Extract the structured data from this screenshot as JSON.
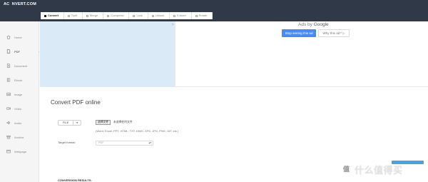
{
  "app": {
    "logo": "AC  NVERT.COM"
  },
  "tabs": [
    {
      "label": "Convert",
      "active": true
    },
    {
      "label": "Split",
      "active": false
    },
    {
      "label": "Merge",
      "active": false
    },
    {
      "label": "Compress",
      "active": false
    },
    {
      "label": "Lock",
      "active": false
    },
    {
      "label": "Unlock",
      "active": false
    },
    {
      "label": "Extract",
      "active": false
    },
    {
      "label": "Rotate",
      "active": false
    }
  ],
  "sidebar": {
    "items": [
      {
        "label": "Home",
        "icon": "home-icon"
      },
      {
        "label": "PDF",
        "icon": "pdf-icon",
        "active": true
      },
      {
        "label": "Document",
        "icon": "document-icon"
      },
      {
        "label": "Ebook",
        "icon": "ebook-icon"
      },
      {
        "label": "Image",
        "icon": "image-icon"
      },
      {
        "label": "Video",
        "icon": "video-icon"
      },
      {
        "label": "Audio",
        "icon": "audio-icon"
      },
      {
        "label": "Archive",
        "icon": "archive-icon"
      },
      {
        "label": "Webpage",
        "icon": "webpage-icon"
      }
    ],
    "collapse_glyph": "‹"
  },
  "ad": {
    "ads_by": "Ads by",
    "brand": "Google",
    "stop_label": "Stop seeing this ad",
    "why_label": "Why this ad? ▷",
    "info_glyph": "▷"
  },
  "main": {
    "title": "Convert PDF online",
    "file_button": "FILE",
    "file_arrow": "▾",
    "choose_label": "选择文件",
    "no_file_label": "未选择任何文件",
    "formats_hint": "(Word, Excel, PPT, HTML, TXT, DWG, XPS, JPG, PNG, GIF, etc.)",
    "target_label": "Target format:",
    "target_value": "PDF",
    "target_arrow": "▴▾",
    "results_heading": "CONVERSION RESULTS:"
  },
  "watermark": {
    "mark": "值",
    "text": "什么值得买"
  },
  "colors": {
    "topbar": "#2f3947",
    "accent": "#4a8bf0",
    "ad_panel": "#daeaf6",
    "sidebar": "#f5f5f5"
  }
}
